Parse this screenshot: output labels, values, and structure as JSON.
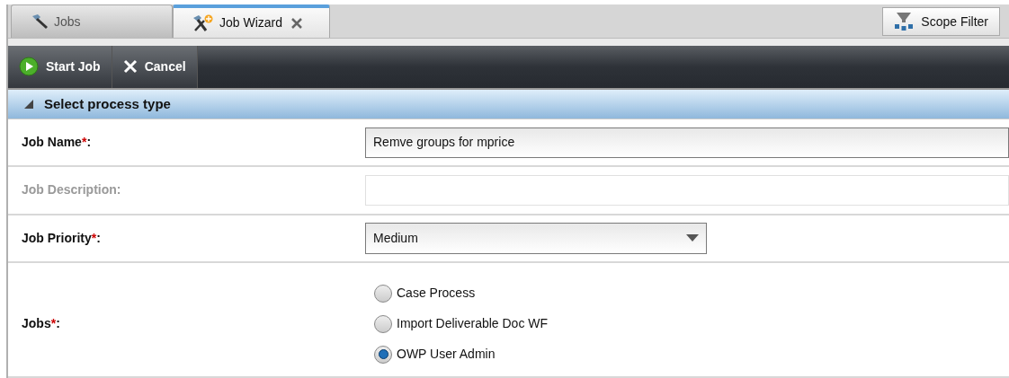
{
  "tabs": [
    {
      "label": "Jobs",
      "selected": false,
      "kind": "hammer"
    },
    {
      "label": "Job Wizard",
      "selected": true,
      "kind": "wizard"
    }
  ],
  "scope_filter": {
    "label": "Scope Filter"
  },
  "toolbar": [
    {
      "label": "Start Job",
      "kind": "play"
    },
    {
      "label": "Cancel",
      "kind": "cancel"
    }
  ],
  "section": {
    "title": "Select process type",
    "expanded": true
  },
  "fields": [
    {
      "kind": "text",
      "label": "Job Name",
      "required_mark": "*",
      "colon": ":",
      "disabled": false,
      "value": "Remve groups for mprice"
    },
    {
      "kind": "text",
      "label": "Job Description",
      "colon": ":",
      "disabled": true
    },
    {
      "kind": "select",
      "label": "Job Priority",
      "required_mark": "*",
      "colon": ":",
      "disabled": false,
      "value": "Medium"
    },
    {
      "kind": "radio",
      "label": "Jobs",
      "required_mark": "*",
      "colon": ":",
      "disabled": false,
      "options": [
        {
          "label": "Case Process",
          "selected": false
        },
        {
          "label": "Import Deliverable Doc WF",
          "selected": false
        },
        {
          "label": "OWP User Admin",
          "selected": true
        }
      ]
    }
  ]
}
